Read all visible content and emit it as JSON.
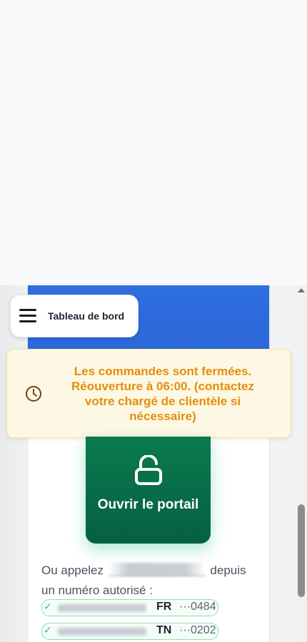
{
  "nav": {
    "label": "Tableau de bord",
    "icon": "hamburger-menu-icon"
  },
  "alert": {
    "icon": "clock-icon",
    "message": "Les commandes sont fermées. Réouverture à 06:00. (contactez votre chargé de clientèle si nécessaire)",
    "text_color": "#e38e0f",
    "background": "#fdf8e3"
  },
  "portal": {
    "icon": "unlock-icon",
    "label": "Ouvrir le portail",
    "color": "#0b7a4e"
  },
  "call": {
    "prefix": "Ou appelez",
    "suffix": "depuis un numéro autorisé :"
  },
  "authorized_numbers": [
    {
      "country": "FR",
      "suffix": "···0484"
    },
    {
      "country": "TN",
      "suffix": "···0202"
    }
  ],
  "header_color": "#2f6fe0"
}
